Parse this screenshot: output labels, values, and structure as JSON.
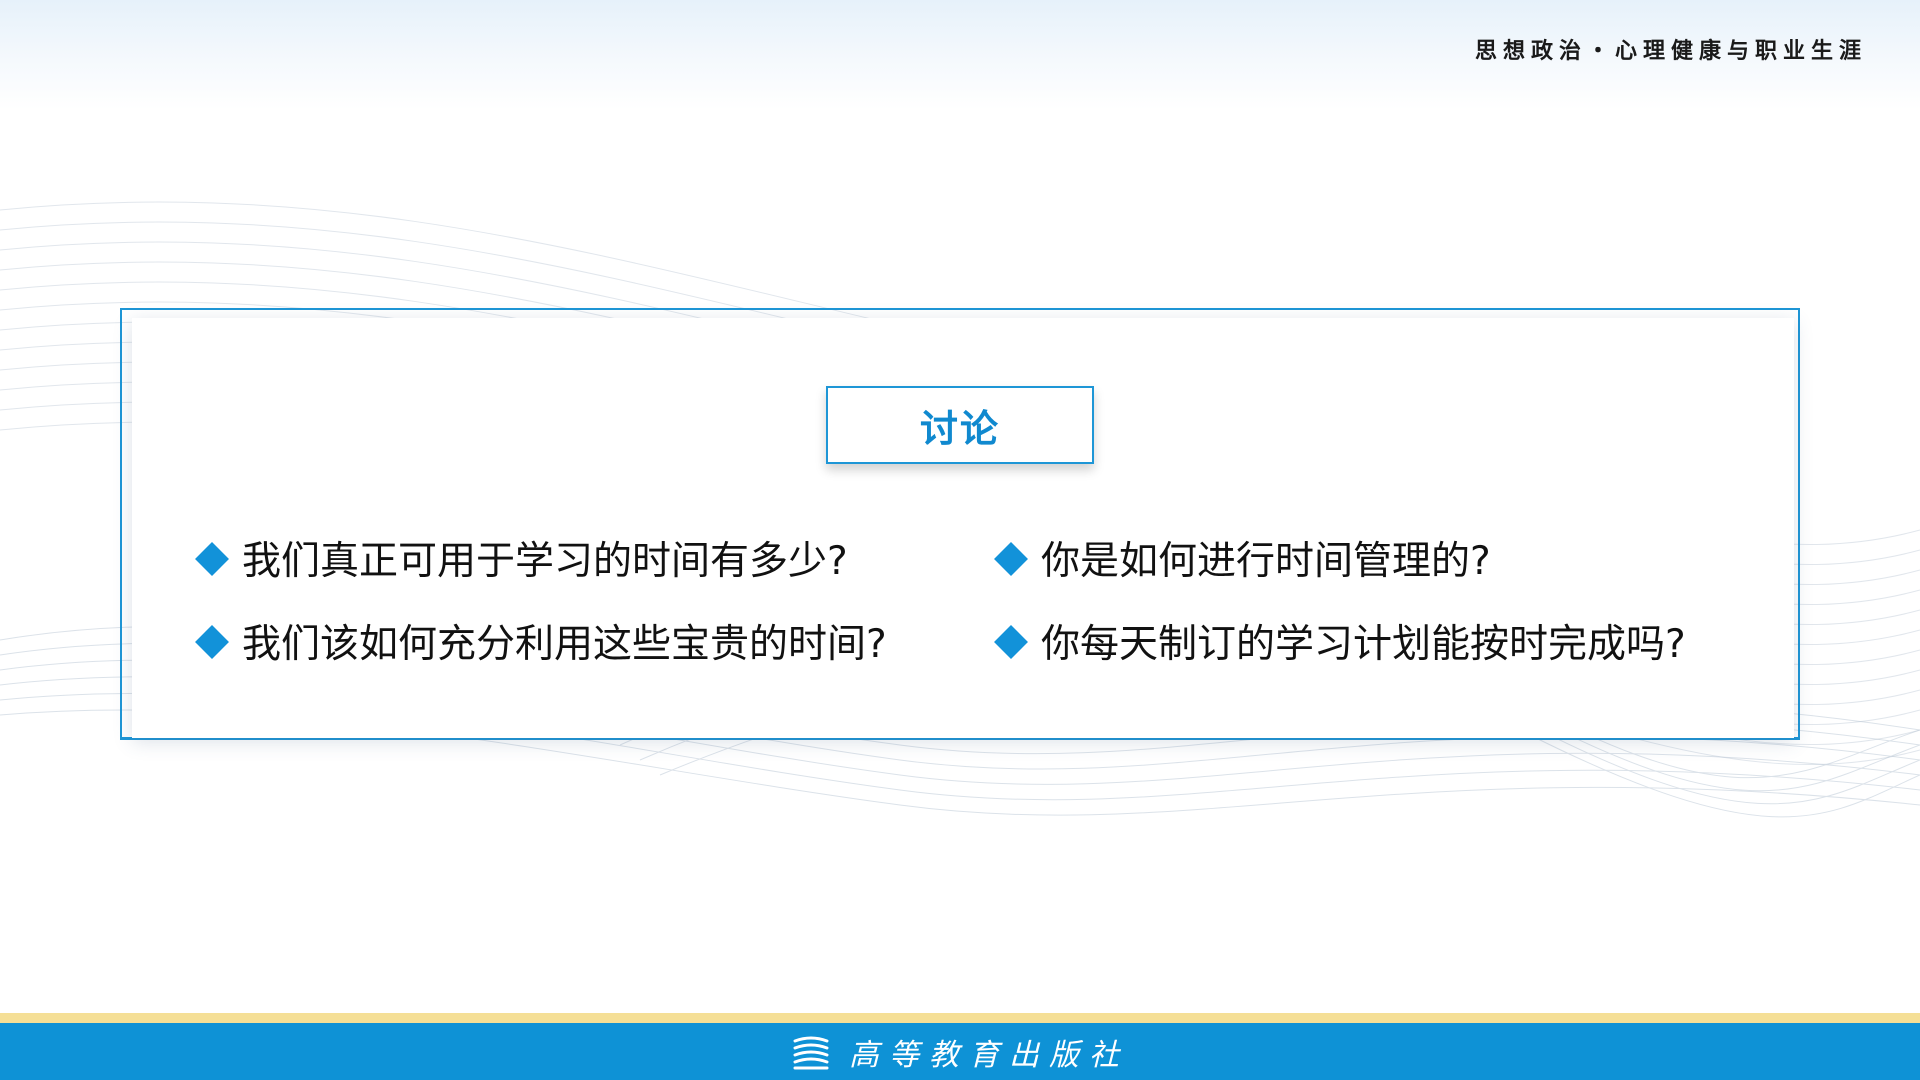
{
  "header": {
    "course_title": "思想政治・心理健康与职业生涯"
  },
  "card": {
    "title": "讨论",
    "questions": [
      "我们真正可用于学习的时间有多少?",
      "我们该如何充分利用这些宝贵的时间?",
      "你是如何进行时间管理的?",
      "你每天制订的学习计划能按时完成吗?"
    ]
  },
  "footer": {
    "publisher": "高等教育出版社"
  },
  "colors": {
    "accent": "#1e96d6",
    "title_text": "#1089cf",
    "footer_blue": "#0e92d6",
    "footer_gold": "#f5df96"
  },
  "icons": {
    "bullet": "diamond-bullet-icon",
    "publisher_logo": "book-stack-logo-icon"
  }
}
